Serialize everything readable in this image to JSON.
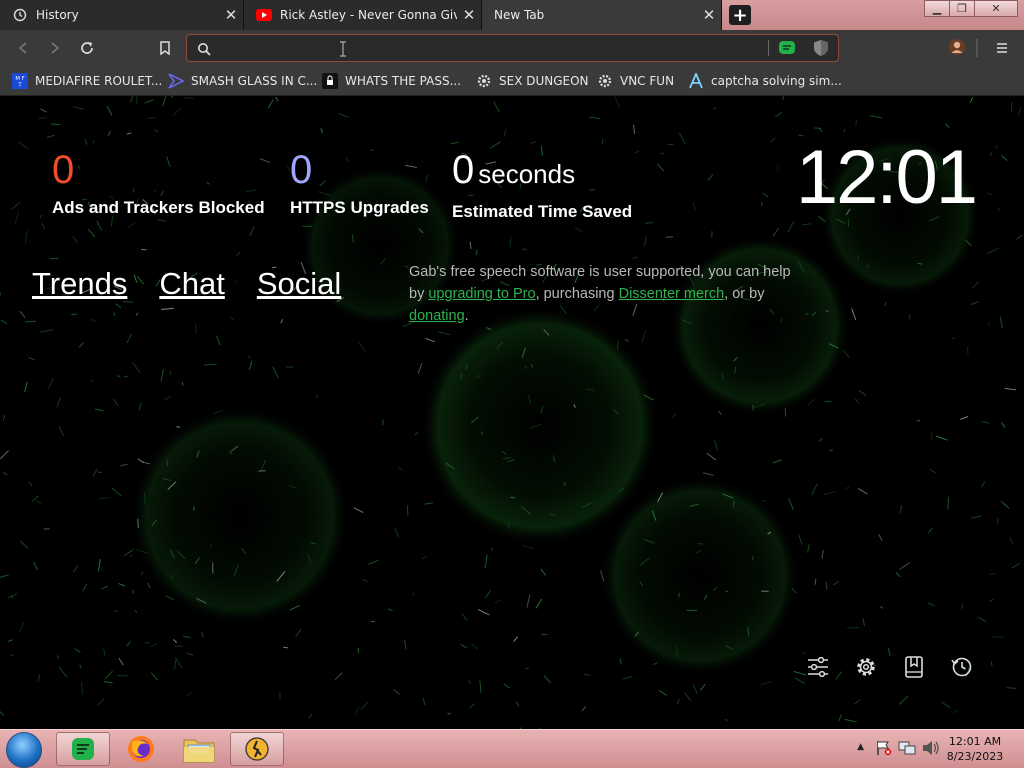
{
  "tabs": [
    {
      "title": "History",
      "icon": "history-icon"
    },
    {
      "title": "Rick Astley - Never Gonna Give Yo",
      "icon": "youtube-icon"
    },
    {
      "title": "New Tab",
      "icon": ""
    }
  ],
  "toolbar": {
    "url_value": "",
    "url_placeholder": ""
  },
  "bookmarks": [
    {
      "label": "MEDIAFIRE ROULET...",
      "icon": "mediafire-icon"
    },
    {
      "label": "SMASH GLASS IN C...",
      "icon": "smash-icon"
    },
    {
      "label": "WHATS THE PASS...",
      "icon": "lock-app-icon"
    },
    {
      "label": "SEX DUNGEON",
      "icon": "gear-bookmark-icon"
    },
    {
      "label": "VNC FUN",
      "icon": "gear-bookmark-icon"
    },
    {
      "label": "captcha solving sim...",
      "icon": "captcha-icon"
    }
  ],
  "stats": {
    "ads_count": "0",
    "ads_label": "Ads and Trackers Blocked",
    "https_count": "0",
    "https_label": "HTTPS Upgrades",
    "time_count": "0",
    "time_unit": "seconds",
    "time_label": "Estimated Time Saved"
  },
  "clock": "12:01",
  "top_links": [
    "Trends",
    "Chat",
    "Social"
  ],
  "gab_message": {
    "part1": "Gab's free speech software is user supported, you can help by ",
    "link1": "upgrading to Pro",
    "part2": ", purchasing ",
    "link2": "Dissenter merch",
    "part3": ", or by ",
    "link3": "donating",
    "part4": "."
  },
  "taskbar": {
    "time": "12:01 AM",
    "date": "8/23/2023"
  },
  "colors": {
    "ads_count": "#f24d2a",
    "https_count": "#a0a6ff",
    "link_green": "#2fb24f",
    "taskbar": "#cf8f91"
  }
}
